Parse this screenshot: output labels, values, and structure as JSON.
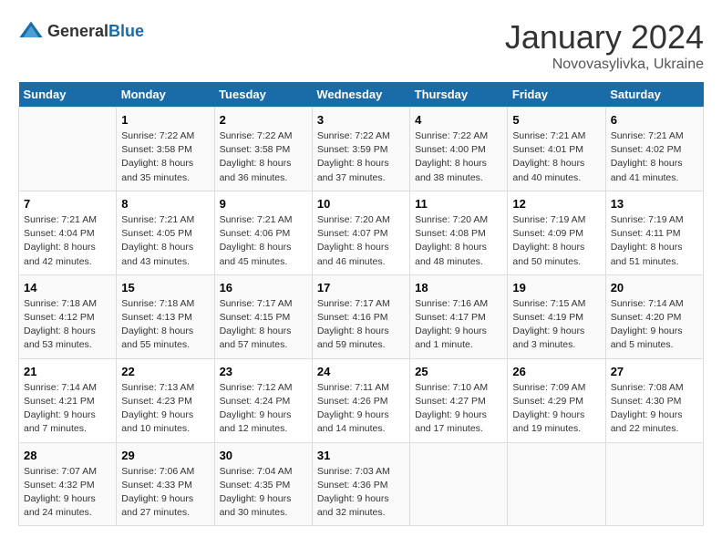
{
  "header": {
    "logo_general": "General",
    "logo_blue": "Blue",
    "title": "January 2024",
    "location": "Novovasylivka, Ukraine"
  },
  "weekdays": [
    "Sunday",
    "Monday",
    "Tuesday",
    "Wednesday",
    "Thursday",
    "Friday",
    "Saturday"
  ],
  "weeks": [
    [
      {
        "day": "",
        "info": ""
      },
      {
        "day": "1",
        "info": "Sunrise: 7:22 AM\nSunset: 3:58 PM\nDaylight: 8 hours\nand 35 minutes."
      },
      {
        "day": "2",
        "info": "Sunrise: 7:22 AM\nSunset: 3:58 PM\nDaylight: 8 hours\nand 36 minutes."
      },
      {
        "day": "3",
        "info": "Sunrise: 7:22 AM\nSunset: 3:59 PM\nDaylight: 8 hours\nand 37 minutes."
      },
      {
        "day": "4",
        "info": "Sunrise: 7:22 AM\nSunset: 4:00 PM\nDaylight: 8 hours\nand 38 minutes."
      },
      {
        "day": "5",
        "info": "Sunrise: 7:21 AM\nSunset: 4:01 PM\nDaylight: 8 hours\nand 40 minutes."
      },
      {
        "day": "6",
        "info": "Sunrise: 7:21 AM\nSunset: 4:02 PM\nDaylight: 8 hours\nand 41 minutes."
      }
    ],
    [
      {
        "day": "7",
        "info": "Sunrise: 7:21 AM\nSunset: 4:04 PM\nDaylight: 8 hours\nand 42 minutes."
      },
      {
        "day": "8",
        "info": "Sunrise: 7:21 AM\nSunset: 4:05 PM\nDaylight: 8 hours\nand 43 minutes."
      },
      {
        "day": "9",
        "info": "Sunrise: 7:21 AM\nSunset: 4:06 PM\nDaylight: 8 hours\nand 45 minutes."
      },
      {
        "day": "10",
        "info": "Sunrise: 7:20 AM\nSunset: 4:07 PM\nDaylight: 8 hours\nand 46 minutes."
      },
      {
        "day": "11",
        "info": "Sunrise: 7:20 AM\nSunset: 4:08 PM\nDaylight: 8 hours\nand 48 minutes."
      },
      {
        "day": "12",
        "info": "Sunrise: 7:19 AM\nSunset: 4:09 PM\nDaylight: 8 hours\nand 50 minutes."
      },
      {
        "day": "13",
        "info": "Sunrise: 7:19 AM\nSunset: 4:11 PM\nDaylight: 8 hours\nand 51 minutes."
      }
    ],
    [
      {
        "day": "14",
        "info": "Sunrise: 7:18 AM\nSunset: 4:12 PM\nDaylight: 8 hours\nand 53 minutes."
      },
      {
        "day": "15",
        "info": "Sunrise: 7:18 AM\nSunset: 4:13 PM\nDaylight: 8 hours\nand 55 minutes."
      },
      {
        "day": "16",
        "info": "Sunrise: 7:17 AM\nSunset: 4:15 PM\nDaylight: 8 hours\nand 57 minutes."
      },
      {
        "day": "17",
        "info": "Sunrise: 7:17 AM\nSunset: 4:16 PM\nDaylight: 8 hours\nand 59 minutes."
      },
      {
        "day": "18",
        "info": "Sunrise: 7:16 AM\nSunset: 4:17 PM\nDaylight: 9 hours\nand 1 minute."
      },
      {
        "day": "19",
        "info": "Sunrise: 7:15 AM\nSunset: 4:19 PM\nDaylight: 9 hours\nand 3 minutes."
      },
      {
        "day": "20",
        "info": "Sunrise: 7:14 AM\nSunset: 4:20 PM\nDaylight: 9 hours\nand 5 minutes."
      }
    ],
    [
      {
        "day": "21",
        "info": "Sunrise: 7:14 AM\nSunset: 4:21 PM\nDaylight: 9 hours\nand 7 minutes."
      },
      {
        "day": "22",
        "info": "Sunrise: 7:13 AM\nSunset: 4:23 PM\nDaylight: 9 hours\nand 10 minutes."
      },
      {
        "day": "23",
        "info": "Sunrise: 7:12 AM\nSunset: 4:24 PM\nDaylight: 9 hours\nand 12 minutes."
      },
      {
        "day": "24",
        "info": "Sunrise: 7:11 AM\nSunset: 4:26 PM\nDaylight: 9 hours\nand 14 minutes."
      },
      {
        "day": "25",
        "info": "Sunrise: 7:10 AM\nSunset: 4:27 PM\nDaylight: 9 hours\nand 17 minutes."
      },
      {
        "day": "26",
        "info": "Sunrise: 7:09 AM\nSunset: 4:29 PM\nDaylight: 9 hours\nand 19 minutes."
      },
      {
        "day": "27",
        "info": "Sunrise: 7:08 AM\nSunset: 4:30 PM\nDaylight: 9 hours\nand 22 minutes."
      }
    ],
    [
      {
        "day": "28",
        "info": "Sunrise: 7:07 AM\nSunset: 4:32 PM\nDaylight: 9 hours\nand 24 minutes."
      },
      {
        "day": "29",
        "info": "Sunrise: 7:06 AM\nSunset: 4:33 PM\nDaylight: 9 hours\nand 27 minutes."
      },
      {
        "day": "30",
        "info": "Sunrise: 7:04 AM\nSunset: 4:35 PM\nDaylight: 9 hours\nand 30 minutes."
      },
      {
        "day": "31",
        "info": "Sunrise: 7:03 AM\nSunset: 4:36 PM\nDaylight: 9 hours\nand 32 minutes."
      },
      {
        "day": "",
        "info": ""
      },
      {
        "day": "",
        "info": ""
      },
      {
        "day": "",
        "info": ""
      }
    ]
  ]
}
